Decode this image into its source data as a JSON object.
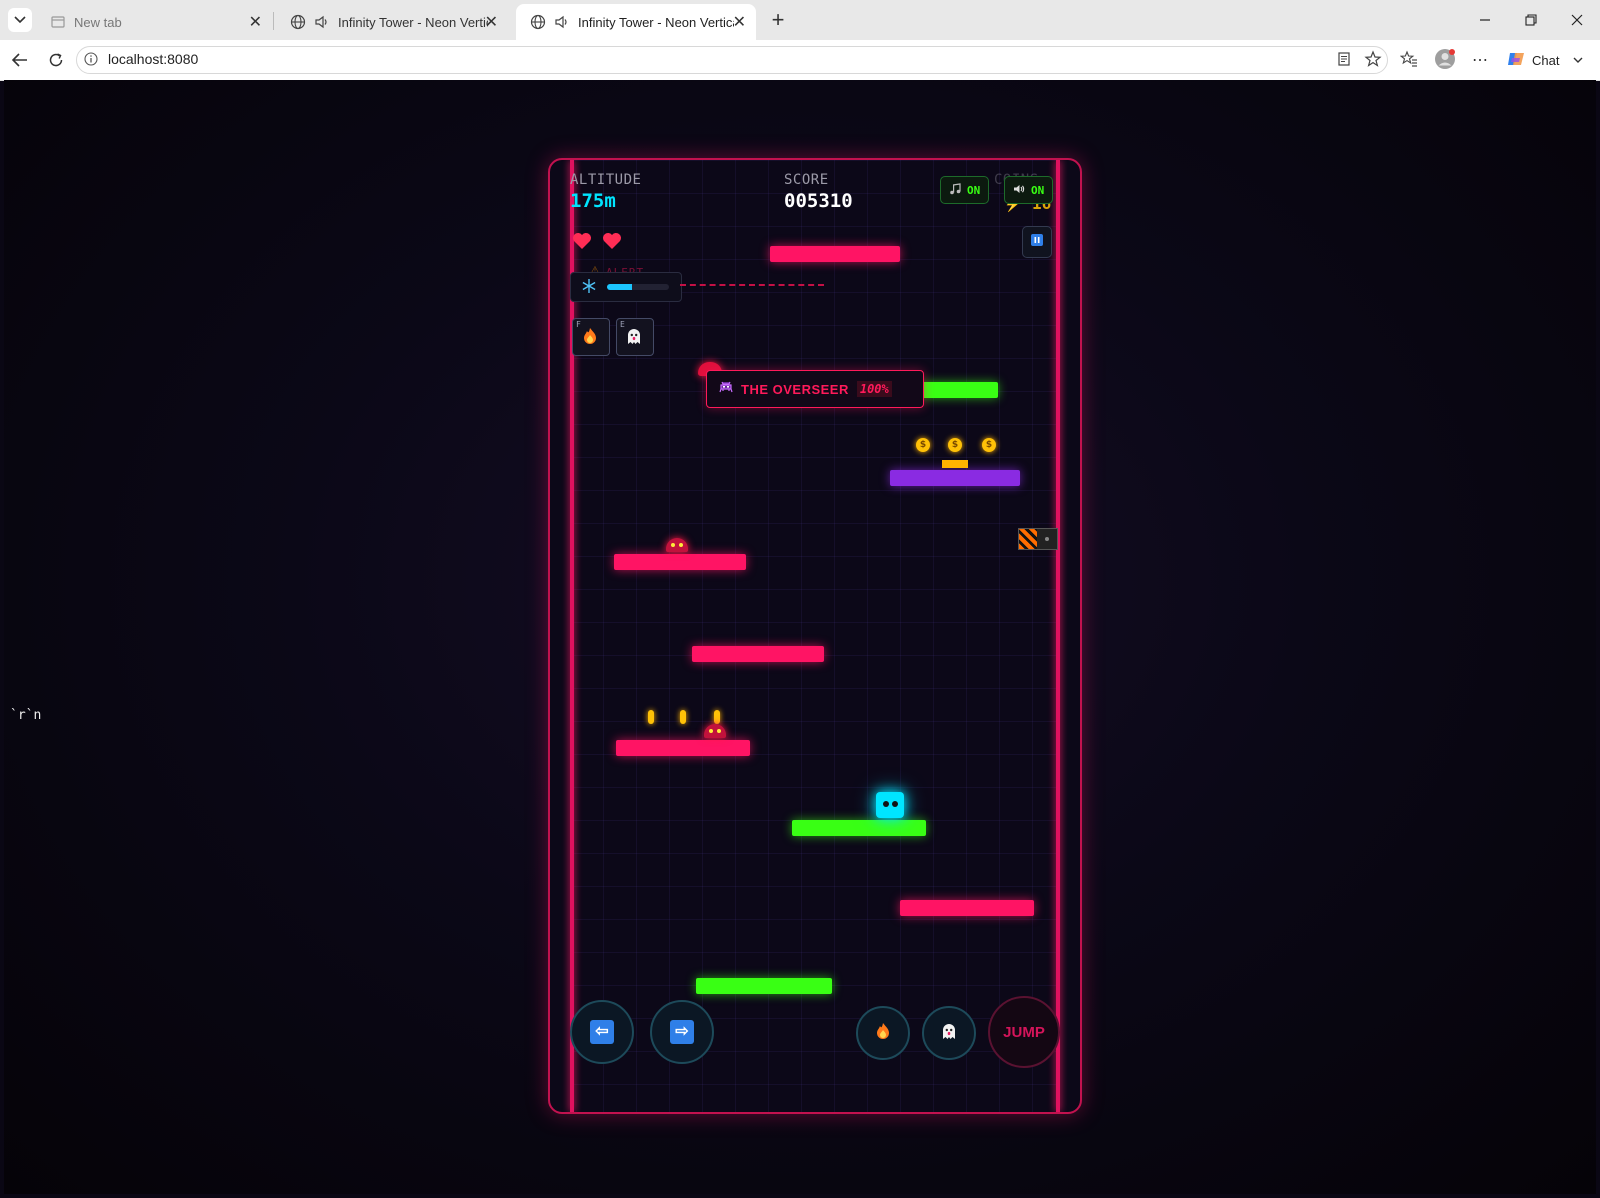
{
  "browser": {
    "tabs": [
      {
        "title": "New tab",
        "active": false
      },
      {
        "title": "Infinity Tower - Neon Vertical",
        "active": false
      },
      {
        "title": "Infinity Tower - Neon Vertical",
        "active": true
      }
    ],
    "url": "localhost:8080",
    "chat_label": "Chat"
  },
  "page": {
    "stray_text": "`r`n"
  },
  "game": {
    "hud": {
      "altitude_label": "ALTITUDE",
      "altitude_value": "175m",
      "score_label": "SCORE",
      "score_value": "005310",
      "coins_label": "COINS",
      "coins_value": "16",
      "music_toggle": "ON",
      "sound_toggle": "ON",
      "lives": 2
    },
    "alert_text": "ALERT",
    "freeze_meter_fraction": 0.4,
    "abilities": [
      {
        "key": "F",
        "icon": "fire-icon"
      },
      {
        "key": "E",
        "icon": "ghost-icon"
      }
    ],
    "boss": {
      "name": "THE OVERSEER",
      "health": "100%"
    },
    "coin_symbol": "$",
    "controls": {
      "left": "left-arrow-icon",
      "right": "right-arrow-icon",
      "fire": "fire-icon",
      "ghost": "ghost-icon",
      "jump_label": "JUMP"
    },
    "colors": {
      "neon_pink": "#ff1464",
      "neon_green": "#39ff14",
      "neon_purple": "#8a2be2",
      "player_cyan": "#00e5ff",
      "coin_gold": "#ffc107"
    }
  }
}
